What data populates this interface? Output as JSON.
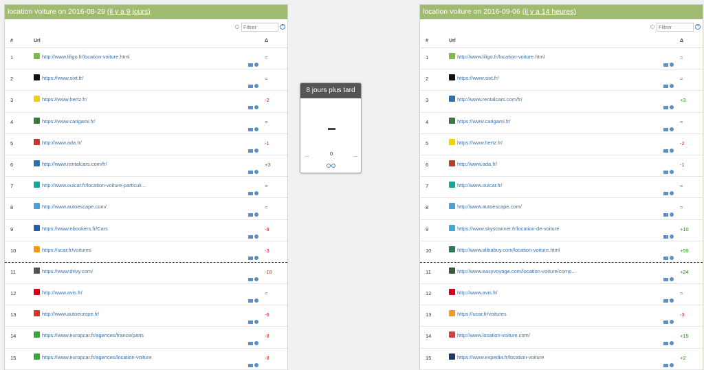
{
  "left": {
    "title": "location voiture on 2016-08-29",
    "ago": "(il y a 9 jours)",
    "filter_placeholder": "Filtrer",
    "col_num": "#",
    "col_url": "Url",
    "col_delta": "Δ",
    "rows": [
      {
        "num": "1",
        "url": "http://www.liligo.fr/location-voiture.html",
        "delta": "=",
        "color": "#7cba4a"
      },
      {
        "num": "2",
        "url": "https://www.sixt.fr/",
        "delta": "=",
        "color": "#111111"
      },
      {
        "num": "3",
        "url": "https://www.hertz.fr/",
        "delta": "-2",
        "color": "#f5d000"
      },
      {
        "num": "4",
        "url": "https://www.carigami.fr/",
        "delta": "=",
        "color": "#3a7a3a"
      },
      {
        "num": "5",
        "url": "http://www.ada.fr/",
        "delta": "-1",
        "color": "#c0392b"
      },
      {
        "num": "6",
        "url": "http://www.rentalcars.com/fr/",
        "delta": "+3",
        "color": "#2f6fb3"
      },
      {
        "num": "7",
        "url": "http://www.ouicar.fr/location-voiture-particuli...",
        "delta": "=",
        "color": "#1aa59a"
      },
      {
        "num": "8",
        "url": "http://www.autoescape.com/",
        "delta": "=",
        "color": "#4aa0d8"
      },
      {
        "num": "9",
        "url": "https://www.ebookers.fr/Cars",
        "delta": "-8",
        "color": "#1f5fa8"
      },
      {
        "num": "10",
        "url": "https://ucar.fr/voitures",
        "delta": "-3",
        "color": "#f39c12"
      },
      {
        "num": "11",
        "url": "https://www.drivy.com/",
        "delta": "-10",
        "color": "#555555"
      },
      {
        "num": "12",
        "url": "http://www.avis.fr/",
        "delta": "=",
        "color": "#d4001a"
      },
      {
        "num": "13",
        "url": "http://www.autoeurope.fr/",
        "delta": "-6",
        "color": "#e03030"
      },
      {
        "num": "14",
        "url": "https://www.europcar.fr/agences/france/paris",
        "delta": "-8",
        "color": "#3aa63a"
      },
      {
        "num": "15",
        "url": "https://www.europcar.fr/agences/location-voiture",
        "delta": "-8",
        "color": "#3aa63a"
      }
    ]
  },
  "right": {
    "title": "location voiture on 2016-09-06",
    "ago": "(il y a 14 heures)",
    "filter_placeholder": "Filtrer",
    "col_num": "#",
    "col_url": "Url",
    "col_delta": "Δ",
    "rows": [
      {
        "num": "1",
        "url": "http://www.liligo.fr/location-voiture.html",
        "delta": "=",
        "color": "#7cba4a"
      },
      {
        "num": "2",
        "url": "https://www.sixt.fr/",
        "delta": "=",
        "color": "#111111"
      },
      {
        "num": "3",
        "url": "http://www.rentalcars.com/fr/",
        "delta": "+3",
        "color": "#2f6fb3"
      },
      {
        "num": "4",
        "url": "https://www.carigami.fr/",
        "delta": "=",
        "color": "#3a7a3a"
      },
      {
        "num": "5",
        "url": "https://www.hertz.fr/",
        "delta": "-2",
        "color": "#f5d000"
      },
      {
        "num": "6",
        "url": "http://www.ada.fr/",
        "delta": "-1",
        "color": "#c0392b"
      },
      {
        "num": "7",
        "url": "http://www.ouicar.fr/",
        "delta": "=",
        "color": "#1aa59a"
      },
      {
        "num": "8",
        "url": "http://www.autoescape.com/",
        "delta": "=",
        "color": "#4aa0d8"
      },
      {
        "num": "9",
        "url": "https://www.skyscanner.fr/location-de-voiture",
        "delta": "+10",
        "color": "#3fa8d8"
      },
      {
        "num": "10",
        "url": "http://www.alibabuy.com/location-voiture.html",
        "delta": "+59",
        "color": "#2a7a5a"
      },
      {
        "num": "11",
        "url": "http://www.easyvoyage.com/location-voiture/comp...",
        "delta": "+24",
        "color": "#3a5a3a"
      },
      {
        "num": "12",
        "url": "http://www.avis.fr/",
        "delta": "=",
        "color": "#d4001a"
      },
      {
        "num": "13",
        "url": "https://ucar.fr/voitures",
        "delta": "-3",
        "color": "#f39c12"
      },
      {
        "num": "14",
        "url": "http://www.location-voiture.com/",
        "delta": "+15",
        "color": "#d04040"
      },
      {
        "num": "15",
        "url": "https://www.expedia.fr/location-voiture",
        "delta": "+2",
        "color": "#1a3a6a"
      }
    ]
  },
  "middle": {
    "title": "8 jours plus tard",
    "dash": "-",
    "ellipsis_left": "...",
    "zero": "0",
    "ellipsis_right": "..."
  }
}
